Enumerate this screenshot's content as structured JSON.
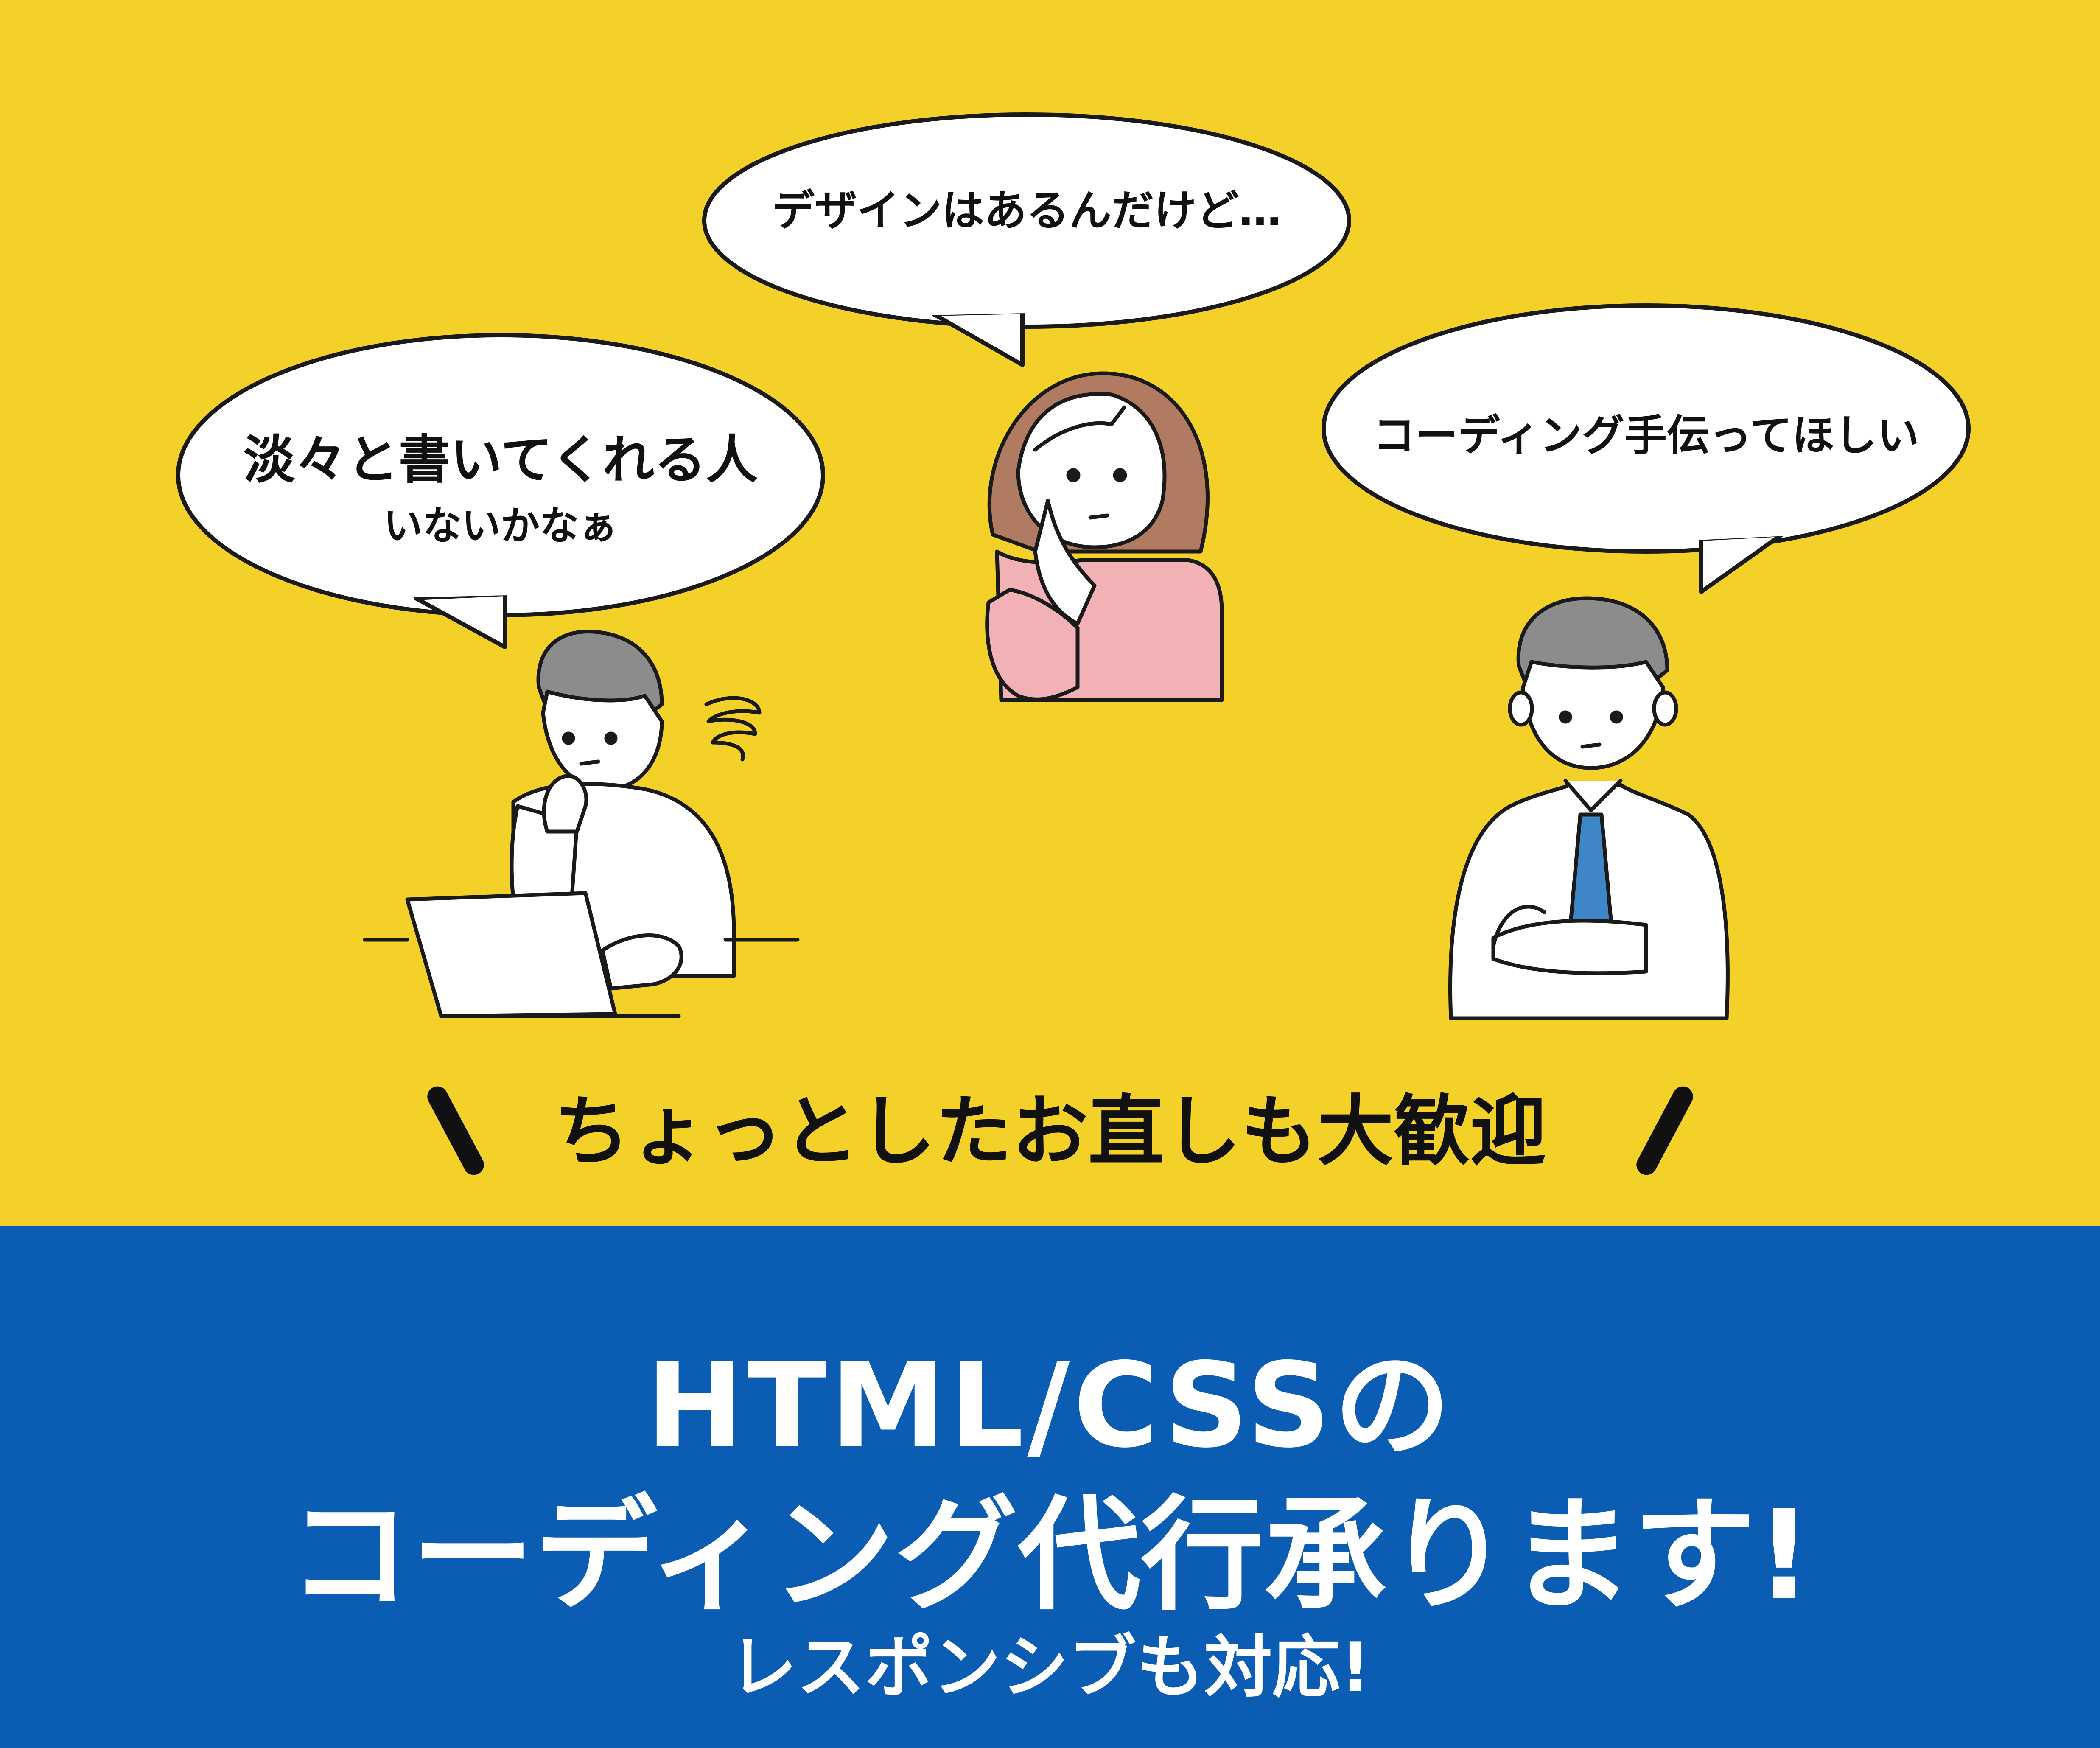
{
  "bubbles": {
    "left_line1": "淡々と書いてくれる人",
    "left_line2": "いないかなぁ",
    "center": "デザインはあるんだけど…",
    "right": "コーディング手伝ってほしい"
  },
  "tagline": "ちょっとしたお直しも大歓迎",
  "headline": {
    "line1": "HTML/CSSの",
    "line2": "コーディング代行承ります!",
    "line3": "レスポンシブも対応!"
  },
  "colors": {
    "background_yellow": "#F4D128",
    "banner_blue": "#0A5DB3",
    "shirt_pink": "#F2B1B4",
    "hair_brown": "#B07B61",
    "hair_gray": "#8C8C8C",
    "tie_blue": "#3F86C6"
  }
}
